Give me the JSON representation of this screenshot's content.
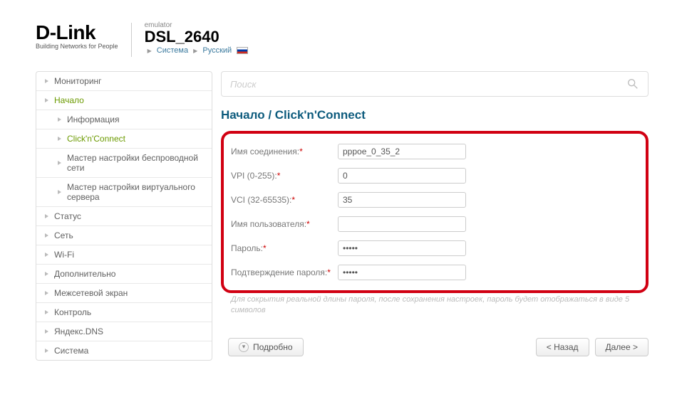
{
  "header": {
    "brand": "D-Link",
    "tagline": "Building Networks for People",
    "emulator": "emulator",
    "model": "DSL_2640",
    "crumb_system": "Система",
    "crumb_lang": "Русский"
  },
  "sidebar": [
    {
      "label": "Мониторинг",
      "sub": false,
      "active": false
    },
    {
      "label": "Начало",
      "sub": false,
      "active": true
    },
    {
      "label": "Информация",
      "sub": true,
      "active": false
    },
    {
      "label": "Click'n'Connect",
      "sub": true,
      "active": true
    },
    {
      "label": "Мастер настройки беспроводной сети",
      "sub": true,
      "active": false
    },
    {
      "label": "Мастер настройки виртуального сервера",
      "sub": true,
      "active": false
    },
    {
      "label": "Статус",
      "sub": false,
      "active": false
    },
    {
      "label": "Сеть",
      "sub": false,
      "active": false
    },
    {
      "label": "Wi-Fi",
      "sub": false,
      "active": false
    },
    {
      "label": "Дополнительно",
      "sub": false,
      "active": false
    },
    {
      "label": "Межсетевой экран",
      "sub": false,
      "active": false
    },
    {
      "label": "Контроль",
      "sub": false,
      "active": false
    },
    {
      "label": "Яндекс.DNS",
      "sub": false,
      "active": false
    },
    {
      "label": "Система",
      "sub": false,
      "active": false
    }
  ],
  "search": {
    "placeholder": "Поиск"
  },
  "page_title": "Начало /  Click'n'Connect",
  "form": {
    "conn_name": {
      "label": "Имя соединения:",
      "value": "pppoe_0_35_2"
    },
    "vpi": {
      "label": "VPI (0-255):",
      "value": "0"
    },
    "vci": {
      "label": "VCI (32-65535):",
      "value": "35"
    },
    "username": {
      "label": "Имя пользователя:",
      "value": ""
    },
    "password": {
      "label": "Пароль:",
      "value": "•••••"
    },
    "password2": {
      "label": "Подтверждение пароля:",
      "value": "•••••"
    }
  },
  "hint": "Для сокрытия реальной длины пароля, после сохранения настроек, пароль будет отображаться в виде 5 символов",
  "buttons": {
    "details": "Подробно",
    "back": "< Назад",
    "next": "Далее >"
  }
}
